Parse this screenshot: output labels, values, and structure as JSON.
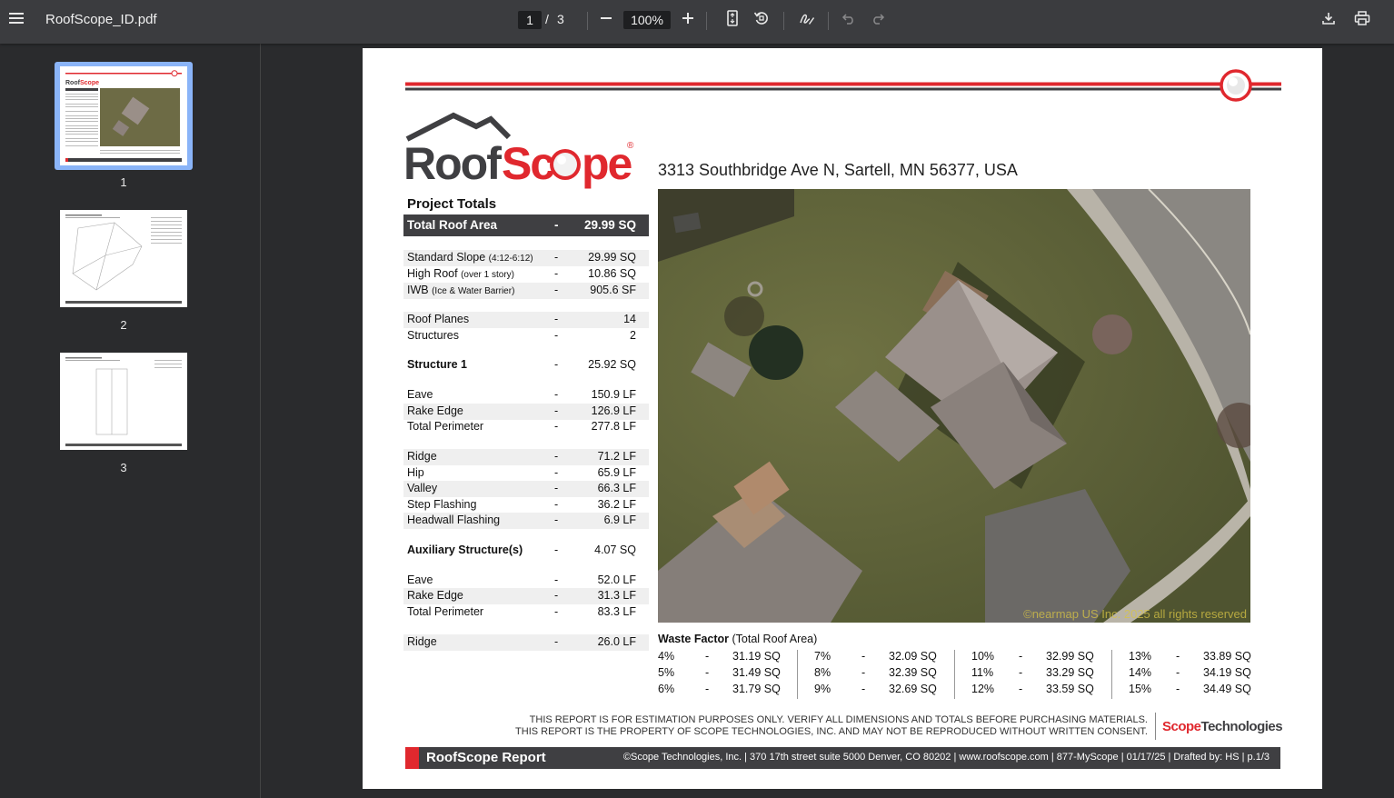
{
  "viewer": {
    "file_name": "RoofScope_ID.pdf",
    "current_page": "1",
    "page_separator": "/",
    "total_pages": "3",
    "zoom": "100%",
    "thumbnails": [
      {
        "label": "1"
      },
      {
        "label": "2"
      },
      {
        "label": "3"
      }
    ],
    "icons": [
      "menu-icon",
      "zoom-out-icon",
      "zoom-in-icon",
      "fit-page-icon",
      "rotate-icon",
      "annotate-icon",
      "undo-icon",
      "redo-icon",
      "download-icon",
      "print-icon"
    ]
  },
  "report": {
    "logo_text_a": "Roof",
    "logo_text_b": "Sc",
    "logo_text_c": "pe",
    "logo_registered": "®",
    "address": "3313 Southbridge Ave N, Sartell, MN 56377, USA",
    "section_title": "Project Totals",
    "rows": [
      {
        "label": "Total Roof Area",
        "note": "",
        "dash": "-",
        "value": "29.99 SQ",
        "style": "dark"
      },
      {
        "label": "Standard Slope",
        "note": "(4:12-6:12)",
        "dash": "-",
        "value": "29.99 SQ",
        "style": "shaded"
      },
      {
        "label": "High Roof",
        "note": "(over 1 story)",
        "dash": "-",
        "value": "10.86 SQ",
        "style": "plain"
      },
      {
        "label": "IWB",
        "note": "(Ice & Water Barrier)",
        "dash": "-",
        "value": "905.6 SF",
        "style": "shaded"
      },
      {
        "label": "Roof Planes",
        "note": "",
        "dash": "-",
        "value": "14",
        "style": "shaded"
      },
      {
        "label": "Structures",
        "note": "",
        "dash": "-",
        "value": "2",
        "style": "plain"
      },
      {
        "label": "Structure 1",
        "note": "",
        "dash": "-",
        "value": "25.92 SQ",
        "style": "bold"
      },
      {
        "label": "Eave",
        "note": "",
        "dash": "-",
        "value": "150.9 LF",
        "style": "plain"
      },
      {
        "label": "Rake Edge",
        "note": "",
        "dash": "-",
        "value": "126.9 LF",
        "style": "shaded"
      },
      {
        "label": "Total Perimeter",
        "note": "",
        "dash": "-",
        "value": "277.8 LF",
        "style": "plain"
      },
      {
        "label": "Ridge",
        "note": "",
        "dash": "-",
        "value": "71.2 LF",
        "style": "shaded"
      },
      {
        "label": "Hip",
        "note": "",
        "dash": "-",
        "value": "65.9 LF",
        "style": "plain"
      },
      {
        "label": "Valley",
        "note": "",
        "dash": "-",
        "value": "66.3 LF",
        "style": "shaded"
      },
      {
        "label": "Step Flashing",
        "note": "",
        "dash": "-",
        "value": "36.2 LF",
        "style": "plain"
      },
      {
        "label": "Headwall Flashing",
        "note": "",
        "dash": "-",
        "value": "6.9 LF",
        "style": "shaded"
      },
      {
        "label": "Auxiliary Structure(s)",
        "note": "",
        "dash": "-",
        "value": "4.07 SQ",
        "style": "bold"
      },
      {
        "label": "Eave",
        "note": "",
        "dash": "-",
        "value": "52.0 LF",
        "style": "plain"
      },
      {
        "label": "Rake Edge",
        "note": "",
        "dash": "-",
        "value": "31.3 LF",
        "style": "shaded"
      },
      {
        "label": "Total Perimeter",
        "note": "",
        "dash": "-",
        "value": "83.3 LF",
        "style": "plain"
      },
      {
        "label": "Ridge",
        "note": "",
        "dash": "-",
        "value": "26.0 LF",
        "style": "shaded"
      }
    ],
    "photo_watermark": "©nearmap US Inc. 2025 all rights reserved",
    "waste_title_bold": "Waste Factor",
    "waste_title_rest": " (Total Roof Area)",
    "waste_factors": [
      {
        "pct": "4%",
        "dash": "-",
        "value": "31.19 SQ"
      },
      {
        "pct": "5%",
        "dash": "-",
        "value": "31.49 SQ"
      },
      {
        "pct": "6%",
        "dash": "-",
        "value": "31.79 SQ"
      },
      {
        "pct": "7%",
        "dash": "-",
        "value": "32.09 SQ"
      },
      {
        "pct": "8%",
        "dash": "-",
        "value": "32.39 SQ"
      },
      {
        "pct": "9%",
        "dash": "-",
        "value": "32.69 SQ"
      },
      {
        "pct": "10%",
        "dash": "-",
        "value": "32.99 SQ"
      },
      {
        "pct": "11%",
        "dash": "-",
        "value": "33.29 SQ"
      },
      {
        "pct": "12%",
        "dash": "-",
        "value": "33.59 SQ"
      },
      {
        "pct": "13%",
        "dash": "-",
        "value": "33.89 SQ"
      },
      {
        "pct": "14%",
        "dash": "-",
        "value": "34.19 SQ"
      },
      {
        "pct": "15%",
        "dash": "-",
        "value": "34.49 SQ"
      }
    ],
    "disclaimer_1": "THIS REPORT IS FOR ESTIMATION PURPOSES ONLY. VERIFY ALL DIMENSIONS AND TOTALS BEFORE PURCHASING MATERIALS.",
    "disclaimer_2": "THIS REPORT IS THE PROPERTY OF SCOPE TECHNOLOGIES, INC. AND MAY NOT BE REPRODUCED WITHOUT WRITTEN CONSENT.",
    "company_logo_a": "Scope",
    "company_logo_b": "Technologies",
    "footer_title": "RoofScope Report",
    "footer_meta": "©Scope Technologies, Inc. | 370 17th street suite 5000 Denver, CO 80202 | www.roofscope.com | 877-MyScope | 01/17/25 | Drafted by: HS | p.1/3"
  },
  "colors": {
    "brand_red": "#e0282e",
    "dark_gray": "#3f3f42",
    "toolbar": "#3b3c3f",
    "viewer_bg": "#2a2b2d",
    "thumb_selected": "#8ab4f8"
  }
}
